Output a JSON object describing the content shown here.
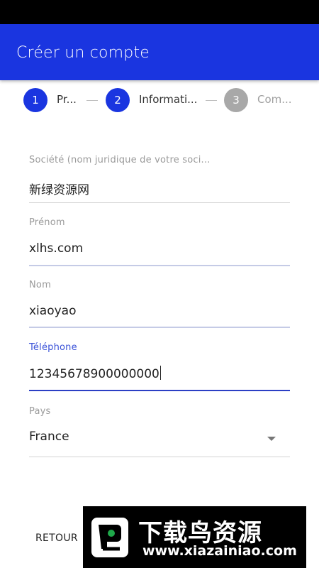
{
  "app_bar": {
    "title": "Créer un compte",
    "color": "#1a35e0"
  },
  "stepper": {
    "steps": [
      {
        "number": "1",
        "label": "Pr...",
        "state": "done",
        "color": "#1a35e0"
      },
      {
        "number": "2",
        "label": "Informati...",
        "state": "current",
        "color": "#1a35e0"
      },
      {
        "number": "3",
        "label": "Com...",
        "state": "pending",
        "color": "#a8a8a8"
      }
    ]
  },
  "form": {
    "company": {
      "label": "Société (nom juridique de votre soci...",
      "value": "新绿资源网"
    },
    "first_name": {
      "label": "Prénom",
      "value": "xlhs.com"
    },
    "last_name": {
      "label": "Nom",
      "value": "xiaoyao"
    },
    "phone": {
      "label": "Téléphone",
      "value": "12345678900000000",
      "active_color": "#2b3fc4"
    },
    "country": {
      "label": "Pays",
      "value": "France",
      "icon": "dropdown-arrow-icon"
    }
  },
  "actions": {
    "back_label": "RETOUR"
  },
  "watermark": {
    "title": "下载鸟资源",
    "url": "www.xiazainiao.com"
  }
}
